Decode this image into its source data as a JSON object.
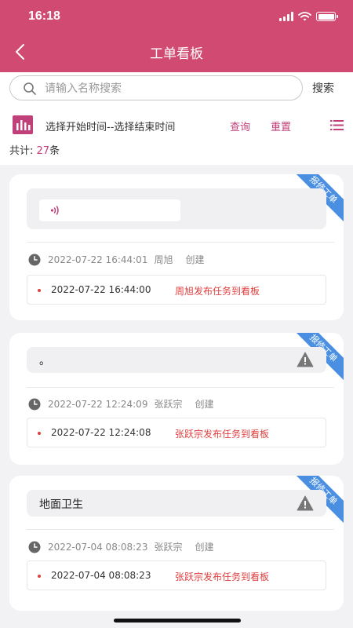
{
  "status_bar": {
    "time": "16:18"
  },
  "header": {
    "title": "工单看板"
  },
  "search": {
    "placeholder": "请输入名称搜索",
    "button_label": "搜索"
  },
  "filter": {
    "range_text": "选择开始时间--选择结束时间",
    "query_label": "查询",
    "reset_label": "重置"
  },
  "summary": {
    "label": "共计:",
    "count": "27",
    "unit": "条"
  },
  "colors": {
    "header": "#d04a72",
    "accent": "#c2407a",
    "ribbon": "#4a8fe2",
    "record_text": "#e04040"
  },
  "cards": [
    {
      "tag": "报修工单",
      "content": "",
      "content_type": "voice",
      "log": {
        "time": "2022-07-22 16:44:01",
        "user": "周旭",
        "action": "创建"
      },
      "record": {
        "time": "2022-07-22 16:44:00",
        "message": "周旭发布任务到看板"
      }
    },
    {
      "tag": "报修工单",
      "content": "。",
      "content_type": "text",
      "log": {
        "time": "2022-07-22 12:24:09",
        "user": "张跃宗",
        "action": "创建"
      },
      "record": {
        "time": "2022-07-22 12:24:08",
        "message": "张跃宗发布任务到看板"
      }
    },
    {
      "tag": "报修工单",
      "content": "地面卫生",
      "content_type": "text",
      "log": {
        "time": "2022-07-04 08:08:23",
        "user": "张跃宗",
        "action": "创建"
      },
      "record": {
        "time": "2022-07-04 08:08:23",
        "message": "张跃宗发布任务到看板"
      }
    }
  ]
}
